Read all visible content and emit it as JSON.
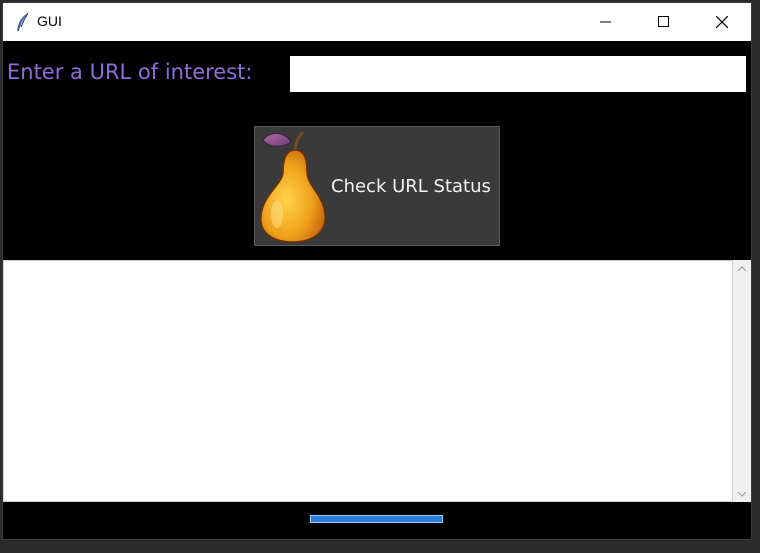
{
  "window": {
    "title": "GUI"
  },
  "form": {
    "url_label": "Enter a URL of interest:",
    "url_value": "",
    "url_placeholder": ""
  },
  "check_button": {
    "label": "Check URL Status",
    "icon": "pear-icon"
  },
  "output": {
    "text": ""
  },
  "colors": {
    "background": "#000000",
    "label": "#8c6fd8",
    "button_bg": "#3a3a3a",
    "button_text": "#f2f2f2",
    "bottom_bar": "#2a7fd8"
  }
}
